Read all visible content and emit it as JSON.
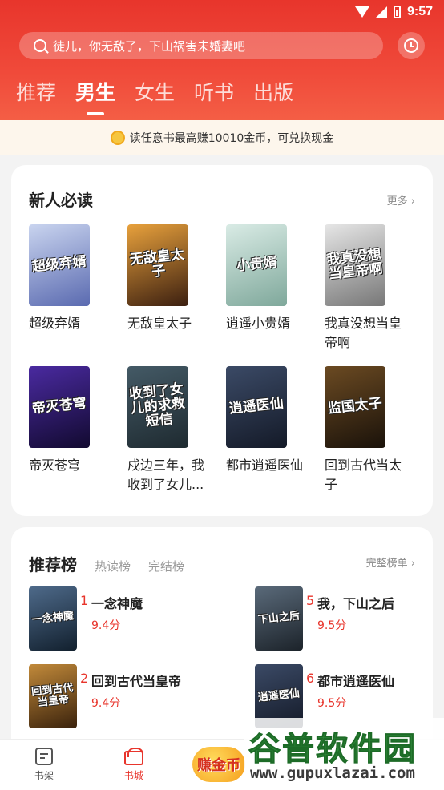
{
  "status": {
    "time": "9:57"
  },
  "header": {
    "search_placeholder": "徒儿，你无敌了，下山祸害未婚妻吧",
    "tabs": [
      {
        "label": "推荐",
        "active": false
      },
      {
        "label": "男生",
        "active": true
      },
      {
        "label": "女生",
        "active": false
      },
      {
        "label": "听书",
        "active": false
      },
      {
        "label": "出版",
        "active": false
      }
    ]
  },
  "notice": {
    "text": "读任意书最高赚10010金币，可兑换现金"
  },
  "new_reader": {
    "title": "新人必读",
    "more": "更多",
    "books": [
      {
        "title": "超级弃婿",
        "cover_text": "超级弃婿",
        "cover_colors": [
          "#c9d4ef",
          "#5a6ab0"
        ]
      },
      {
        "title": "无敌皇太子",
        "cover_text": "无敌皇太子",
        "cover_colors": [
          "#e8a13c",
          "#3b1f10"
        ]
      },
      {
        "title": "逍遥小贵婿",
        "cover_text": "小贵婿",
        "cover_colors": [
          "#d9ebe5",
          "#7fa89b"
        ]
      },
      {
        "title": "我真没想当皇帝啊",
        "cover_text": "我真没想当皇帝啊",
        "cover_colors": [
          "#e6e6e6",
          "#777777"
        ]
      },
      {
        "title": "帝灭苍穹",
        "cover_text": "帝灭苍穹",
        "cover_colors": [
          "#4a2aa0",
          "#120a30"
        ]
      },
      {
        "title": "戍边三年，我收到了女儿...",
        "cover_text": "收到了女儿的求救短信",
        "cover_colors": [
          "#445a66",
          "#1e2a30"
        ]
      },
      {
        "title": "都市逍遥医仙",
        "cover_text": "逍遥医仙",
        "cover_colors": [
          "#3b4a66",
          "#141a28"
        ]
      },
      {
        "title": "回到古代当太子",
        "cover_text": "监国太子",
        "cover_colors": [
          "#6b4a22",
          "#1a120a"
        ]
      }
    ]
  },
  "ranking": {
    "tabs": [
      "推荐榜",
      "热读榜",
      "完结榜"
    ],
    "more": "完整榜单",
    "items": [
      {
        "rank": "1",
        "title": "一念神魔",
        "score": "9.4分",
        "cover_text": "一念神魔",
        "cover_colors": [
          "#4e6a8a",
          "#12202e"
        ]
      },
      {
        "rank": "5",
        "title": "我，下山之后",
        "score": "9.5分",
        "cover_text": "下山之后",
        "cover_colors": [
          "#5a6a7a",
          "#1c232a"
        ]
      },
      {
        "rank": "2",
        "title": "回到古代当皇帝",
        "score": "9.4分",
        "cover_text": "回到古代当皇帝",
        "cover_colors": [
          "#c28a3a",
          "#3a220c"
        ]
      },
      {
        "rank": "6",
        "title": "都市逍遥医仙",
        "score": "9.5分",
        "cover_text": "逍遥医仙",
        "cover_colors": [
          "#3b4a66",
          "#141a28"
        ]
      }
    ]
  },
  "bottom_nav": {
    "shelf": "书架",
    "store": "书城",
    "earn": "赚金币"
  },
  "watermark": {
    "text": "谷普软件园",
    "url": "www.gupuxlazai.com"
  }
}
